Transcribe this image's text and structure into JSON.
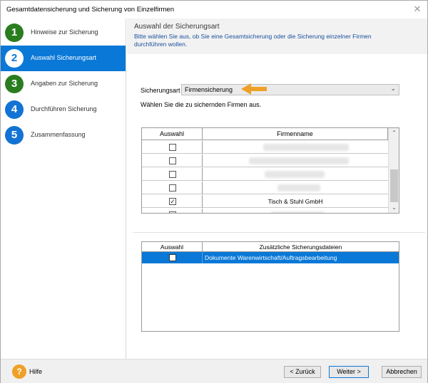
{
  "window": {
    "title": "Gesamtdatensicherung und Sicherung von Einzelfirmen",
    "close_glyph": "✕"
  },
  "sidebar": {
    "steps": [
      {
        "number": "1",
        "label": "Hinweise zur Sicherung",
        "state": "done"
      },
      {
        "number": "2",
        "label": "Auswahl Sicherungsart",
        "state": "active"
      },
      {
        "number": "3",
        "label": "Angaben zur Sicherung",
        "state": "done"
      },
      {
        "number": "4",
        "label": "Durchführen Sicherung",
        "state": "pending"
      },
      {
        "number": "5",
        "label": "Zusammenfassung",
        "state": "pending"
      }
    ]
  },
  "header": {
    "title": "Auswahl der Sicherungsart",
    "description": "Bitte wählen Sie aus, ob Sie eine Gesamtsicherung oder die Sicherung einzelner Firmen durchführen wollen."
  },
  "form": {
    "type_label": "Sicherungsart",
    "type_value": "Firmensicherung",
    "choose_text": "Wählen Sie die zu sichernden Firmen aus."
  },
  "firms_table": {
    "col_select": "Auswahl",
    "col_name": "Firmenname",
    "rows": [
      {
        "checked": false,
        "name": ""
      },
      {
        "checked": false,
        "name": ""
      },
      {
        "checked": false,
        "name": ""
      },
      {
        "checked": false,
        "name": ""
      },
      {
        "checked": true,
        "name": "Tisch & Stuhl GmbH"
      },
      {
        "checked": false,
        "name": ""
      }
    ]
  },
  "extra_table": {
    "col_select": "Auswahl",
    "col_name": "Zusätzliche Sicherungsdateien",
    "rows": [
      {
        "checked": false,
        "name": "Dokumente Warenwirtschaft/Auftragsbearbeitung",
        "selected": true
      }
    ]
  },
  "footer": {
    "help_glyph": "?",
    "help_label": "Hilfe",
    "back_label": "< Zurück",
    "next_label": "Weiter >",
    "cancel_label": "Abbrechen"
  },
  "colors": {
    "accent": "#0a78d7",
    "step_done": "#2a7d1f",
    "step_pending": "#1273d4",
    "pointer_arrow": "#f0a028"
  }
}
